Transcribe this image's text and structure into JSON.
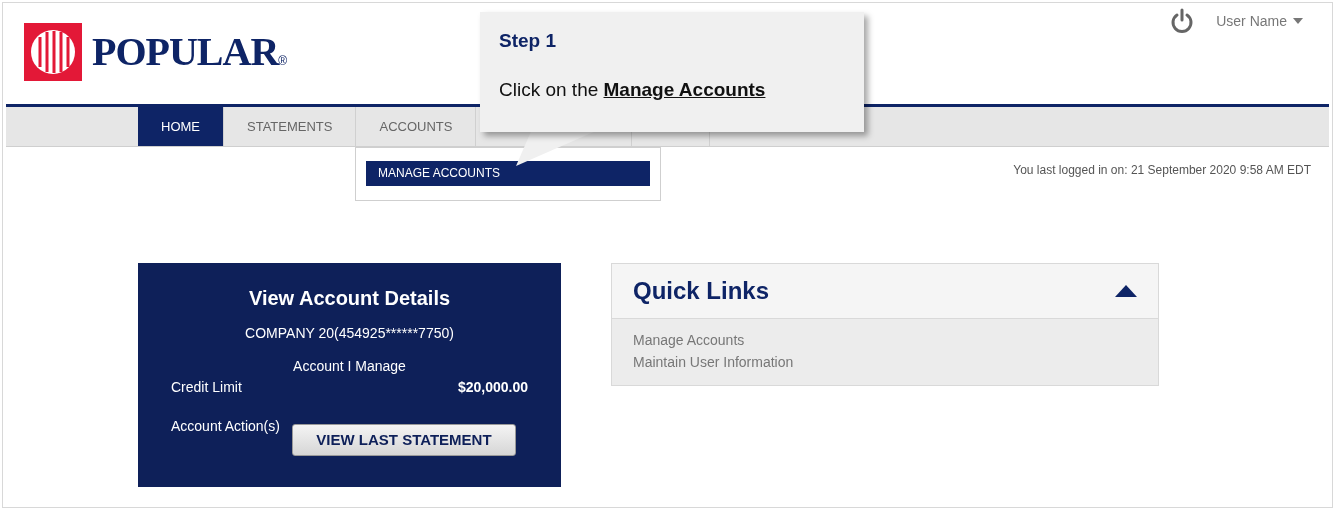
{
  "header": {
    "brand": "POPULAR",
    "brand_mark": "®",
    "user_menu": "User Name",
    "last_login": "You last logged in on: 21 September 2020 9:58 AM EDT"
  },
  "nav": {
    "tabs": [
      {
        "label": "HOME",
        "selected": true
      },
      {
        "label": "STATEMENTS",
        "selected": false
      },
      {
        "label": "ACCOUNTS",
        "selected": false
      }
    ],
    "dropdown": {
      "items": [
        {
          "label": "MANAGE ACCOUNTS",
          "selected": true
        }
      ]
    }
  },
  "callout": {
    "title": "Step 1",
    "text": "Click on the **Manage Accounts**"
  },
  "account_card": {
    "title": "View Account Details",
    "account": "COMPANY 20(454925******7750)",
    "role": "Account I Manage",
    "credit_limit_label": "Credit Limit",
    "credit_limit": "$20,000.00",
    "actions_label": "Account Action(s)",
    "action_button": "VIEW LAST STATEMENT"
  },
  "quick_links": {
    "title": "Quick Links",
    "expanded": true,
    "links": [
      "Manage Accounts",
      "Maintain User Information"
    ]
  }
}
